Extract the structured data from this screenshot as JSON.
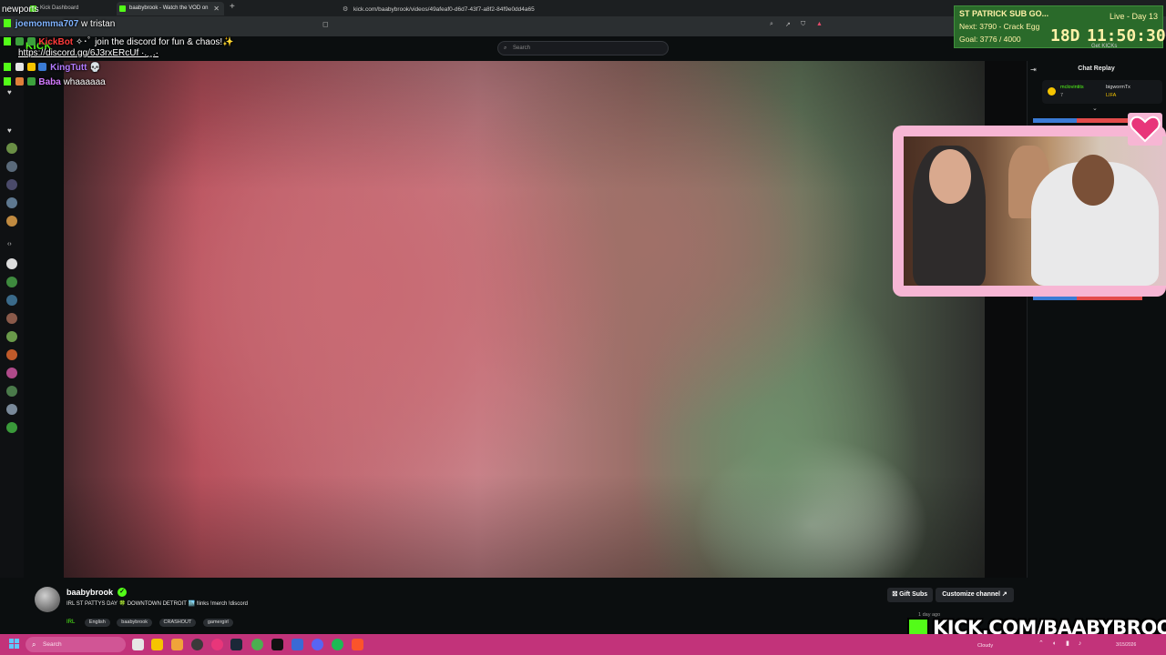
{
  "browser": {
    "tabs": [
      {
        "label": "Kick Dashboard"
      },
      {
        "label": "baabybrook - Watch the VOD on"
      }
    ],
    "url": "kick.com/baabybrook/videos/49afeaf0-d6d7-43f7-a8f2-84f9e0dd4a65"
  },
  "kick": {
    "logo": "KICK",
    "search_placeholder": "Search"
  },
  "chat_panel": {
    "title": "Chat Replay",
    "pinned": {
      "user1": "mclovintits",
      "note1": "7",
      "user2": "bigwormTx",
      "note2": "LIFA"
    }
  },
  "overlay_chat": {
    "header": "newports",
    "messages": [
      {
        "user": "joemomma707",
        "user_color": "#7fb3ff",
        "text": "w tristan"
      },
      {
        "user": "KickBot",
        "user_color": "#ff3b3b",
        "text": "✧･ﾟ join the discord for fun & chaos!✨"
      },
      {
        "user": "",
        "user_color": "#ffffff",
        "text": "https://discord.gg/6J3rxERcUf ·.¸¸.·"
      },
      {
        "user": "KingTutt",
        "user_color": "#b37bff",
        "text": "💀"
      },
      {
        "user": "Baba",
        "user_color": "#d47bff",
        "text": "whaaaaaa"
      }
    ]
  },
  "subathon": {
    "title": "ST PATRICK SUB GO...",
    "live": "Live - Day 13",
    "next": "Next: 3790 - Crack Egg",
    "goal": "Goal: 3776 / 4000",
    "days": "18D",
    "clock": "11:50:30",
    "get_kicks": "Get KICKs"
  },
  "channel": {
    "name": "baabybrook",
    "stream_title": "IRL ST PATTYS DAY 🍀 DOWNTOWN DETROIT 🏙️ !links !merch !discord",
    "category": "IRL",
    "tags": [
      "English",
      "baabybrook",
      "CRASHOUT",
      "gamergirl"
    ],
    "gift_subs_label": "Gift Subs",
    "customize_label": "Customize channel ↗",
    "views": "1 day ago"
  },
  "watermark": "KICK.COM/BAABYBROOK",
  "taskbar": {
    "search_placeholder": "Search",
    "weather": "Cloudy",
    "date": "3/15/2026"
  },
  "colors": {
    "kick_green": "#53fc18",
    "taskbar": "#c2337a",
    "webcam_border": "#f7b6d4"
  }
}
